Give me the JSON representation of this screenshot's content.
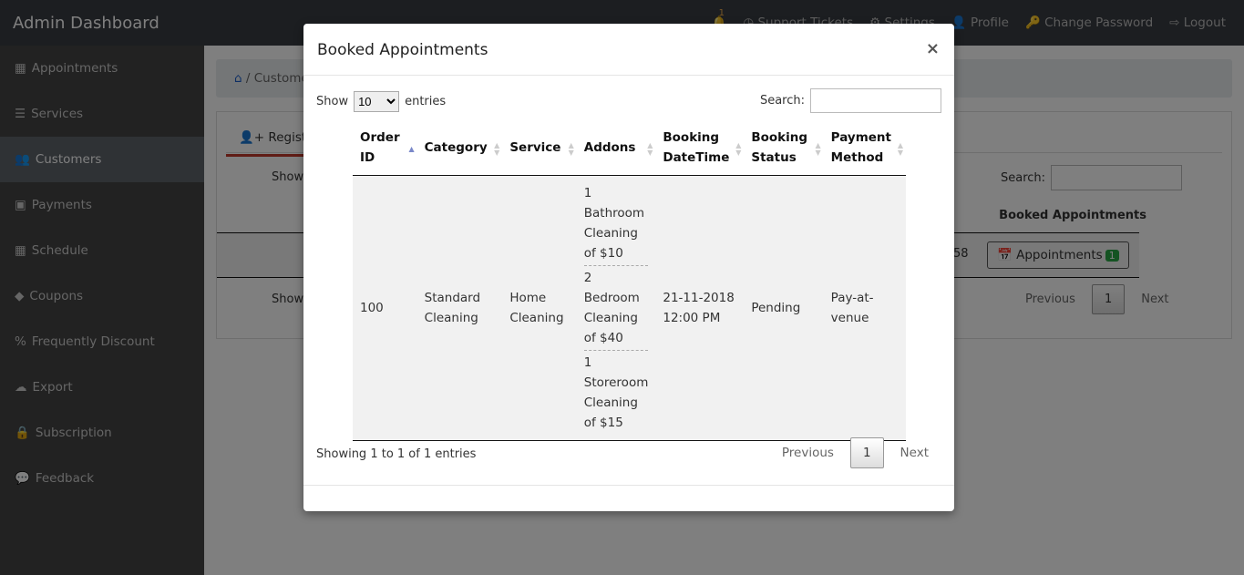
{
  "app": {
    "title": "Admin Dashboard"
  },
  "topnav": {
    "bell_count": "1",
    "support": "Support Tickets",
    "settings": "Settings",
    "profile": "Profile",
    "change_password": "Change Password",
    "logout": "Logout"
  },
  "sidebar": {
    "items": [
      {
        "label": "Appointments",
        "icon": "calendar-icon"
      },
      {
        "label": "Services",
        "icon": "list-icon"
      },
      {
        "label": "Customers",
        "icon": "users-icon"
      },
      {
        "label": "Payments",
        "icon": "money-icon"
      },
      {
        "label": "Schedule",
        "icon": "calendar-grid-icon"
      },
      {
        "label": "Coupons",
        "icon": "tag-icon"
      },
      {
        "label": "Frequently Discount",
        "icon": "percent-icon"
      },
      {
        "label": "Export",
        "icon": "cloud-upload-icon"
      },
      {
        "label": "Subscription",
        "icon": "lock-icon"
      },
      {
        "label": "Feedback",
        "icon": "comments-icon"
      }
    ]
  },
  "breadcrumb": {
    "sep": "/",
    "current": "Customers"
  },
  "background": {
    "tab": "Registered",
    "show": "Show",
    "showing": "Showing",
    "search": "Search:",
    "col_booked": "Booked Appointments",
    "partial_num": "58",
    "appt_button": "Appointments",
    "appt_badge": "1",
    "prev": "Previous",
    "page": "1",
    "next": "Next"
  },
  "modal": {
    "title": "Booked Appointments",
    "close": "×",
    "show": "Show",
    "entries_value": "10",
    "entries": "entries",
    "search": "Search:",
    "columns": [
      "Order ID",
      "Category",
      "Service",
      "Addons",
      "Booking DateTime",
      "Booking Status",
      "Payment Method"
    ],
    "rows": [
      {
        "order_id": "100",
        "category": "Standard Cleaning",
        "service": "Home Cleaning",
        "addons": [
          "1 Bathroom Cleaning of $10",
          "2 Bedroom Cleaning of $40",
          "1 Storeroom Cleaning of $15"
        ],
        "datetime": "21-11-2018 12:00 PM",
        "status": "Pending",
        "payment": "Pay-at-venue"
      }
    ],
    "info": "Showing 1 to 1 of 1 entries",
    "prev": "Previous",
    "page": "1",
    "next": "Next"
  }
}
